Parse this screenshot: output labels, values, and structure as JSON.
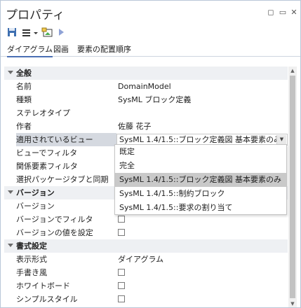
{
  "window": {
    "title": "プロパティ",
    "title_buttons": [
      {
        "name": "float-icon",
        "glyph": "◻"
      },
      {
        "name": "pin-icon",
        "glyph": "⊓"
      },
      {
        "name": "close-icon",
        "glyph": "✕"
      }
    ]
  },
  "toolbar": {
    "icons": [
      "save-icon",
      "menu-icon",
      "dropdown-arrow-icon",
      "image-icon",
      "play-icon"
    ]
  },
  "tabs": [
    "ダイアグラム",
    "図画",
    "要素の配置順序"
  ],
  "properties": {
    "sections": [
      {
        "title": "全般",
        "rows": [
          {
            "name": "名前",
            "value": "DomainModel"
          },
          {
            "name": "種類",
            "value": "SysML ブロック定義"
          },
          {
            "name": "ステレオタイプ",
            "value": ""
          },
          {
            "name": "作者",
            "value": "佐藤 花子"
          },
          {
            "name": "適用されているビュー",
            "value": "SysML 1.4/1.5::ブロック定義図 基本要素のみ"
          },
          {
            "name": "ビューでフィルタ",
            "value": ""
          },
          {
            "name": "関係要素フィルタ",
            "value": ""
          },
          {
            "name": "選択パッケージタブと同期",
            "value": ""
          }
        ]
      },
      {
        "title": "バージョン",
        "rows": [
          {
            "name": "バージョン",
            "value": ""
          },
          {
            "name": "バージョンでフィルタ",
            "value": ""
          },
          {
            "name": "バージョンの値を設定",
            "value": ""
          }
        ]
      },
      {
        "title": "書式設定",
        "rows": [
          {
            "name": "表示形式",
            "value": "ダイアグラム"
          },
          {
            "name": "手書き風",
            "value": ""
          },
          {
            "name": "ホワイトボード",
            "value": ""
          },
          {
            "name": "シンプルスタイル",
            "value": ""
          }
        ]
      }
    ]
  },
  "dropdown": {
    "options": [
      "既定",
      "完全",
      "SysML 1.4/1.5::ブロック定義図 基本要素のみ",
      "SysML 1.4/1.5::制約ブロック",
      "SysML 1.4/1.5::要求の割り当て"
    ],
    "selected_index": 2
  },
  "colors": {
    "accent": "#4b6fb4",
    "section_bg": "#eef0f3",
    "selected_bg": "#c9c9c9"
  }
}
